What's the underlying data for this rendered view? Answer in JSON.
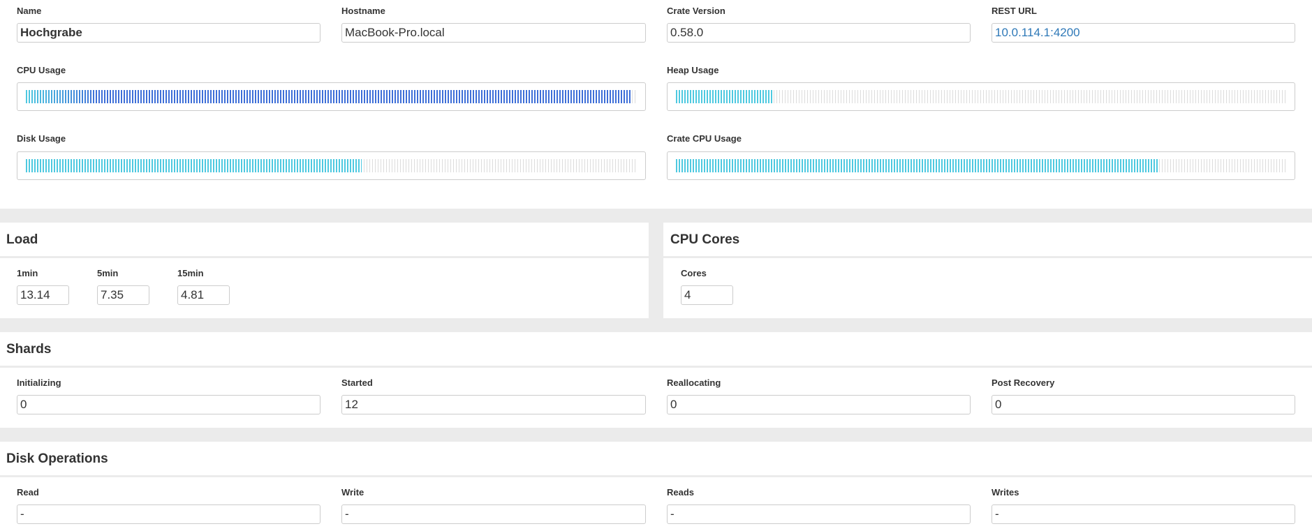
{
  "node": {
    "name_label": "Name",
    "name_value": "Hochgrabe",
    "hostname_label": "Hostname",
    "hostname_value": "MacBook-Pro.local",
    "version_label": "Crate Version",
    "version_value": "0.58.0",
    "rest_label": "REST URL",
    "rest_value": "10.0.114.1:4200"
  },
  "usage": {
    "cpu": {
      "label": "CPU Usage",
      "fraction": 0.99,
      "fill": "gradient-blue"
    },
    "heap": {
      "label": "Heap Usage",
      "fraction": 0.16
    },
    "disk": {
      "label": "Disk Usage",
      "fraction": 0.55
    },
    "crate_cpu": {
      "label": "Crate CPU Usage",
      "fraction": 0.79
    }
  },
  "colors": {
    "cyan": "#4ec9e0",
    "blue": "#3e6fd8",
    "gray_bar": "#dcdcdc",
    "link": "#2f79b8"
  },
  "load": {
    "title": "Load",
    "min1_label": "1min",
    "min1_value": "13.14",
    "min5_label": "5min",
    "min5_value": "7.35",
    "min15_label": "15min",
    "min15_value": "4.81"
  },
  "cpu_cores": {
    "title": "CPU Cores",
    "cores_label": "Cores",
    "cores_value": "4"
  },
  "shards": {
    "title": "Shards",
    "initializing_label": "Initializing",
    "initializing_value": "0",
    "started_label": "Started",
    "started_value": "12",
    "reallocating_label": "Reallocating",
    "reallocating_value": "0",
    "post_recovery_label": "Post Recovery",
    "post_recovery_value": "0"
  },
  "disk_ops": {
    "title": "Disk Operations",
    "read_label": "Read",
    "read_value": "-",
    "write_label": "Write",
    "write_value": "-",
    "reads_label": "Reads",
    "reads_value": "-",
    "writes_label": "Writes",
    "writes_value": "-"
  }
}
